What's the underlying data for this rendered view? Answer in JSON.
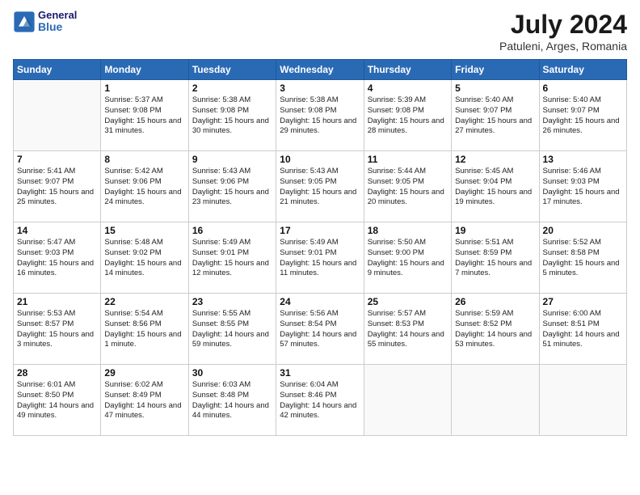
{
  "header": {
    "logo": {
      "general": "General",
      "blue": "Blue"
    },
    "title": "July 2024",
    "subtitle": "Patuleni, Arges, Romania"
  },
  "weekdays": [
    "Sunday",
    "Monday",
    "Tuesday",
    "Wednesday",
    "Thursday",
    "Friday",
    "Saturday"
  ],
  "weeks": [
    [
      {
        "day": null,
        "info": null
      },
      {
        "day": "1",
        "sunrise": "5:37 AM",
        "sunset": "9:08 PM",
        "daylight": "15 hours and 31 minutes."
      },
      {
        "day": "2",
        "sunrise": "5:38 AM",
        "sunset": "9:08 PM",
        "daylight": "15 hours and 30 minutes."
      },
      {
        "day": "3",
        "sunrise": "5:38 AM",
        "sunset": "9:08 PM",
        "daylight": "15 hours and 29 minutes."
      },
      {
        "day": "4",
        "sunrise": "5:39 AM",
        "sunset": "9:08 PM",
        "daylight": "15 hours and 28 minutes."
      },
      {
        "day": "5",
        "sunrise": "5:40 AM",
        "sunset": "9:07 PM",
        "daylight": "15 hours and 27 minutes."
      },
      {
        "day": "6",
        "sunrise": "5:40 AM",
        "sunset": "9:07 PM",
        "daylight": "15 hours and 26 minutes."
      }
    ],
    [
      {
        "day": "7",
        "sunrise": "5:41 AM",
        "sunset": "9:07 PM",
        "daylight": "15 hours and 25 minutes."
      },
      {
        "day": "8",
        "sunrise": "5:42 AM",
        "sunset": "9:06 PM",
        "daylight": "15 hours and 24 minutes."
      },
      {
        "day": "9",
        "sunrise": "5:43 AM",
        "sunset": "9:06 PM",
        "daylight": "15 hours and 23 minutes."
      },
      {
        "day": "10",
        "sunrise": "5:43 AM",
        "sunset": "9:05 PM",
        "daylight": "15 hours and 21 minutes."
      },
      {
        "day": "11",
        "sunrise": "5:44 AM",
        "sunset": "9:05 PM",
        "daylight": "15 hours and 20 minutes."
      },
      {
        "day": "12",
        "sunrise": "5:45 AM",
        "sunset": "9:04 PM",
        "daylight": "15 hours and 19 minutes."
      },
      {
        "day": "13",
        "sunrise": "5:46 AM",
        "sunset": "9:03 PM",
        "daylight": "15 hours and 17 minutes."
      }
    ],
    [
      {
        "day": "14",
        "sunrise": "5:47 AM",
        "sunset": "9:03 PM",
        "daylight": "15 hours and 16 minutes."
      },
      {
        "day": "15",
        "sunrise": "5:48 AM",
        "sunset": "9:02 PM",
        "daylight": "15 hours and 14 minutes."
      },
      {
        "day": "16",
        "sunrise": "5:49 AM",
        "sunset": "9:01 PM",
        "daylight": "15 hours and 12 minutes."
      },
      {
        "day": "17",
        "sunrise": "5:49 AM",
        "sunset": "9:01 PM",
        "daylight": "15 hours and 11 minutes."
      },
      {
        "day": "18",
        "sunrise": "5:50 AM",
        "sunset": "9:00 PM",
        "daylight": "15 hours and 9 minutes."
      },
      {
        "day": "19",
        "sunrise": "5:51 AM",
        "sunset": "8:59 PM",
        "daylight": "15 hours and 7 minutes."
      },
      {
        "day": "20",
        "sunrise": "5:52 AM",
        "sunset": "8:58 PM",
        "daylight": "15 hours and 5 minutes."
      }
    ],
    [
      {
        "day": "21",
        "sunrise": "5:53 AM",
        "sunset": "8:57 PM",
        "daylight": "15 hours and 3 minutes."
      },
      {
        "day": "22",
        "sunrise": "5:54 AM",
        "sunset": "8:56 PM",
        "daylight": "15 hours and 1 minute."
      },
      {
        "day": "23",
        "sunrise": "5:55 AM",
        "sunset": "8:55 PM",
        "daylight": "14 hours and 59 minutes."
      },
      {
        "day": "24",
        "sunrise": "5:56 AM",
        "sunset": "8:54 PM",
        "daylight": "14 hours and 57 minutes."
      },
      {
        "day": "25",
        "sunrise": "5:57 AM",
        "sunset": "8:53 PM",
        "daylight": "14 hours and 55 minutes."
      },
      {
        "day": "26",
        "sunrise": "5:59 AM",
        "sunset": "8:52 PM",
        "daylight": "14 hours and 53 minutes."
      },
      {
        "day": "27",
        "sunrise": "6:00 AM",
        "sunset": "8:51 PM",
        "daylight": "14 hours and 51 minutes."
      }
    ],
    [
      {
        "day": "28",
        "sunrise": "6:01 AM",
        "sunset": "8:50 PM",
        "daylight": "14 hours and 49 minutes."
      },
      {
        "day": "29",
        "sunrise": "6:02 AM",
        "sunset": "8:49 PM",
        "daylight": "14 hours and 47 minutes."
      },
      {
        "day": "30",
        "sunrise": "6:03 AM",
        "sunset": "8:48 PM",
        "daylight": "14 hours and 44 minutes."
      },
      {
        "day": "31",
        "sunrise": "6:04 AM",
        "sunset": "8:46 PM",
        "daylight": "14 hours and 42 minutes."
      },
      {
        "day": null,
        "info": null
      },
      {
        "day": null,
        "info": null
      },
      {
        "day": null,
        "info": null
      }
    ]
  ]
}
